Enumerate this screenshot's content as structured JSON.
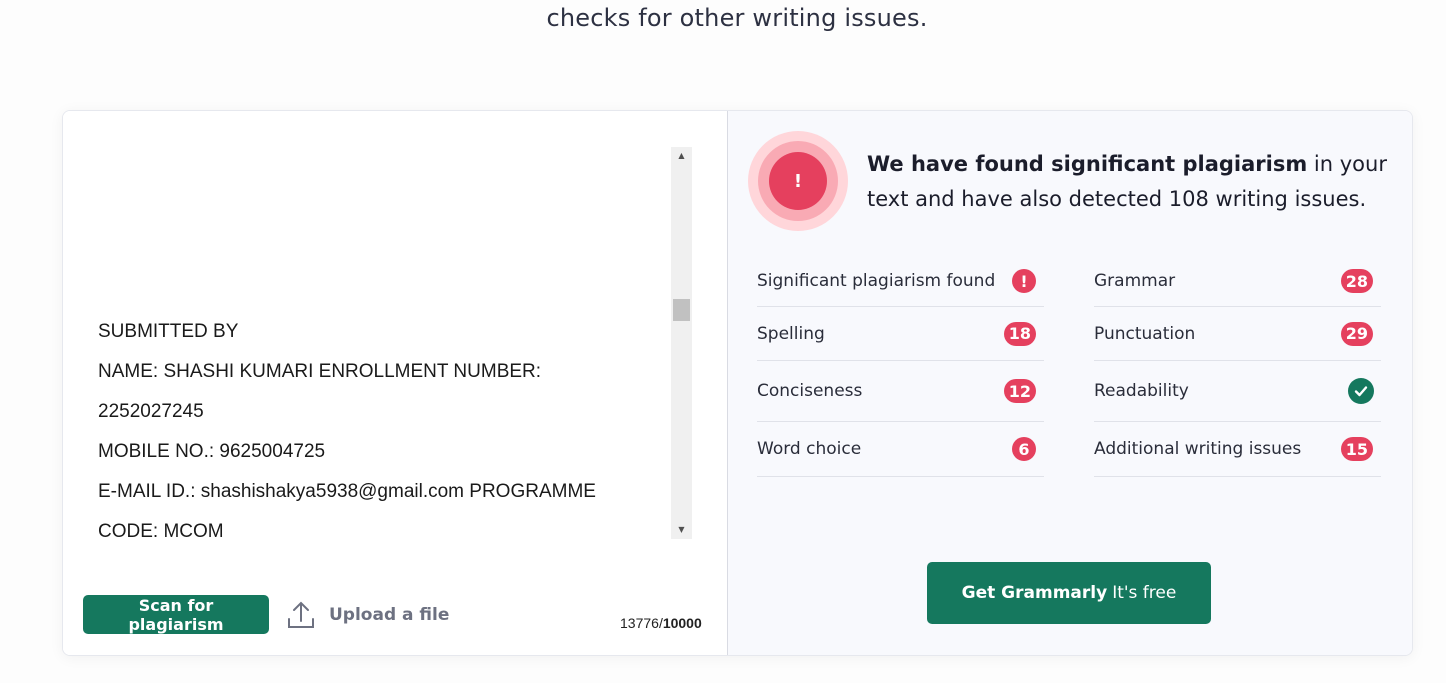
{
  "intro_text": "checks for other writing issues.",
  "editor": {
    "lines": [
      "SUBMITTED BY",
      "NAME: SHASHI KUMARI ENROLLMENT NUMBER:",
      "2252027245",
      "MOBILE NO.: 9625004725",
      "E-MAIL ID.: shashishakya5938@gmail.com PROGRAMME",
      "CODE: MCOM"
    ],
    "scan_label": "Scan for plagiarism",
    "upload_label": "Upload a file",
    "char_count": "13776",
    "char_limit": "10000"
  },
  "result": {
    "alert_symbol": "!",
    "headline_bold": "We have found significant plagiarism",
    "headline_rest": " in your text and have also detected 108 writing issues.",
    "issues_left": [
      {
        "label": "Significant plagiarism found",
        "value": "!",
        "icon": "alert-icon"
      },
      {
        "label": "Spelling",
        "value": "18"
      },
      {
        "label": "Conciseness",
        "value": "12"
      },
      {
        "label": "Word choice",
        "value": "6"
      }
    ],
    "issues_right": [
      {
        "label": "Grammar",
        "value": "28"
      },
      {
        "label": "Punctuation",
        "value": "29"
      },
      {
        "label": "Readability",
        "value": "",
        "icon": "check-icon"
      },
      {
        "label": "Additional writing issues",
        "value": "15"
      }
    ],
    "cta_bold": "Get Grammarly",
    "cta_rest": "It's free"
  },
  "colors": {
    "brand_green": "#15785e",
    "alert_red": "#e5405e"
  }
}
